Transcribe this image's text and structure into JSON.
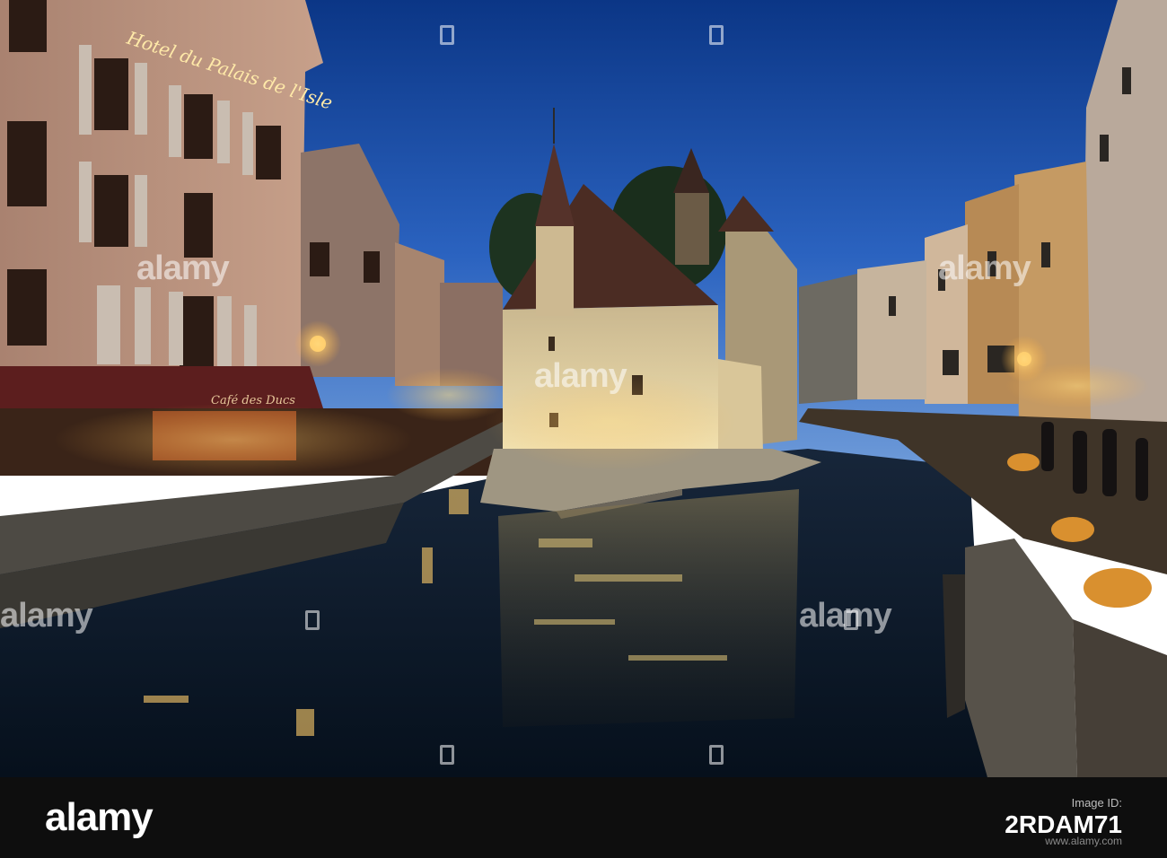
{
  "photo": {
    "hotel_sign": "Hotel du Palais de l'Isle",
    "cafe_sign": "Café des Ducs"
  },
  "watermark": {
    "text": "alamy"
  },
  "footer": {
    "logo": "alamy",
    "image_id_label": "Image ID:",
    "image_id": "2RDAM71",
    "site": "www.alamy.com"
  },
  "colors": {
    "sky_top": "#0d3a8a",
    "sky_bottom": "#5a8fd6",
    "water": "#0a1a2c",
    "castle_light": "#e8d9a8",
    "lamp_glow": "#ffcf6a",
    "footer_bg": "#0e0e0e"
  }
}
